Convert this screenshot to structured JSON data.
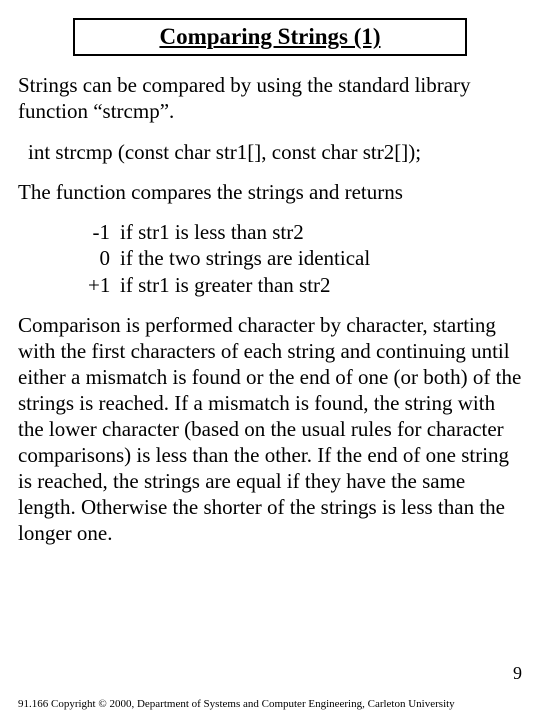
{
  "title": "Comparing Strings (1)",
  "intro": "Strings can be compared by using the standard library function “strcmp”.",
  "signature": "int strcmp (const char str1[], const char str2[]);",
  "returns_intro": "The function compares the strings and returns",
  "returns": [
    {
      "k": "-1",
      "v": "if str1 is less than str2"
    },
    {
      "k": "0",
      "v": "if the two strings are identical"
    },
    {
      "k": "+1",
      "v": "if str1 is greater than str2"
    }
  ],
  "explanation": "Comparison is performed character by character, starting with the first characters of each string and continuing until either a mismatch is found or the end of one (or both) of the strings is reached.  If a mismatch is found, the string with the lower character (based on the usual rules for character comparisons) is less than the other.  If the end of one string is reached, the strings are equal if they have the same length.  Otherwise the shorter of the strings is less than the longer one.",
  "page_number": "9",
  "copyright": "91.166 Copyright © 2000, Department of Systems and Computer Engineering, Carleton University"
}
